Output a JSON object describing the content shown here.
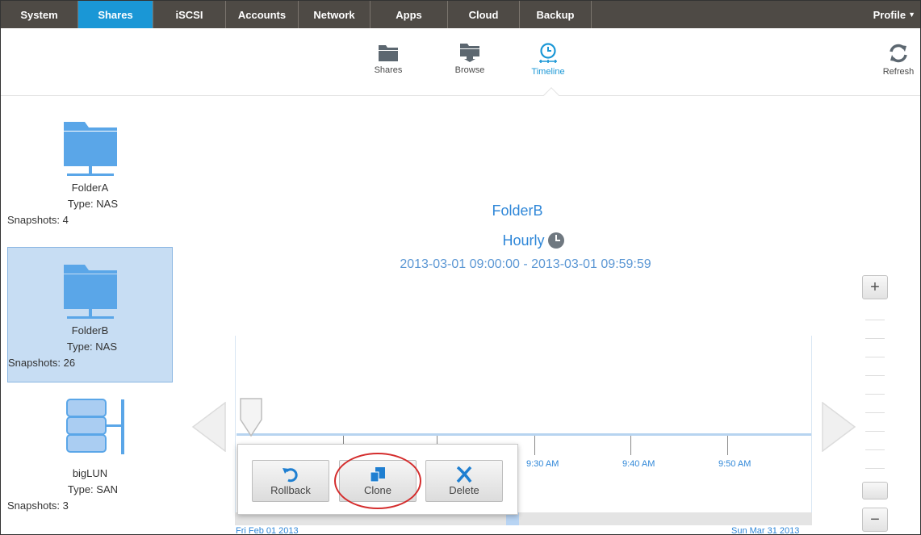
{
  "nav": {
    "tabs": [
      {
        "label": "System"
      },
      {
        "label": "Shares"
      },
      {
        "label": "iSCSI"
      },
      {
        "label": "Accounts"
      },
      {
        "label": "Network"
      },
      {
        "label": "Apps"
      },
      {
        "label": "Cloud"
      },
      {
        "label": "Backup"
      }
    ],
    "active_tab": "Shares",
    "profile_label": "Profile"
  },
  "toolbar": {
    "shares_label": "Shares",
    "browse_label": "Browse",
    "timeline_label": "Timeline",
    "refresh_label": "Refresh",
    "active_tool": "Timeline"
  },
  "volumes": [
    {
      "name": "FolderA",
      "type": "Type: NAS",
      "snapshots": "Snapshots: 4",
      "icon": "folder-icon",
      "selected": false
    },
    {
      "name": "FolderB",
      "type": "Type: NAS",
      "snapshots": "Snapshots: 26",
      "icon": "folder-icon",
      "selected": true
    },
    {
      "name": "bigLUN",
      "type": "Type: SAN",
      "snapshots": "Snapshots: 3",
      "icon": "lun-icon",
      "selected": false
    }
  ],
  "detail": {
    "share_name": "FolderB",
    "schedule": "Hourly",
    "date_range": "2013-03-01 09:00:00  -  2013-03-01 09:59:59"
  },
  "timeline": {
    "tick_labels": [
      "9:30 AM",
      "9:40 AM",
      "9:50 AM"
    ],
    "range_start": "Fri Feb 01 2013",
    "range_end": "Sun Mar 31 2013"
  },
  "popup": {
    "rollback_label": "Rollback",
    "clone_label": "Clone",
    "delete_label": "Delete"
  },
  "zoom": {
    "plus": "+",
    "minus": "−"
  },
  "colors": {
    "nav_bg": "#4e4a45",
    "nav_active": "#1a97d6",
    "accent_blue": "#2f87d8",
    "icon_blue": "#5aa6e8",
    "selection_bg": "#c7ddf3",
    "highlight_red": "#d42d2d"
  }
}
